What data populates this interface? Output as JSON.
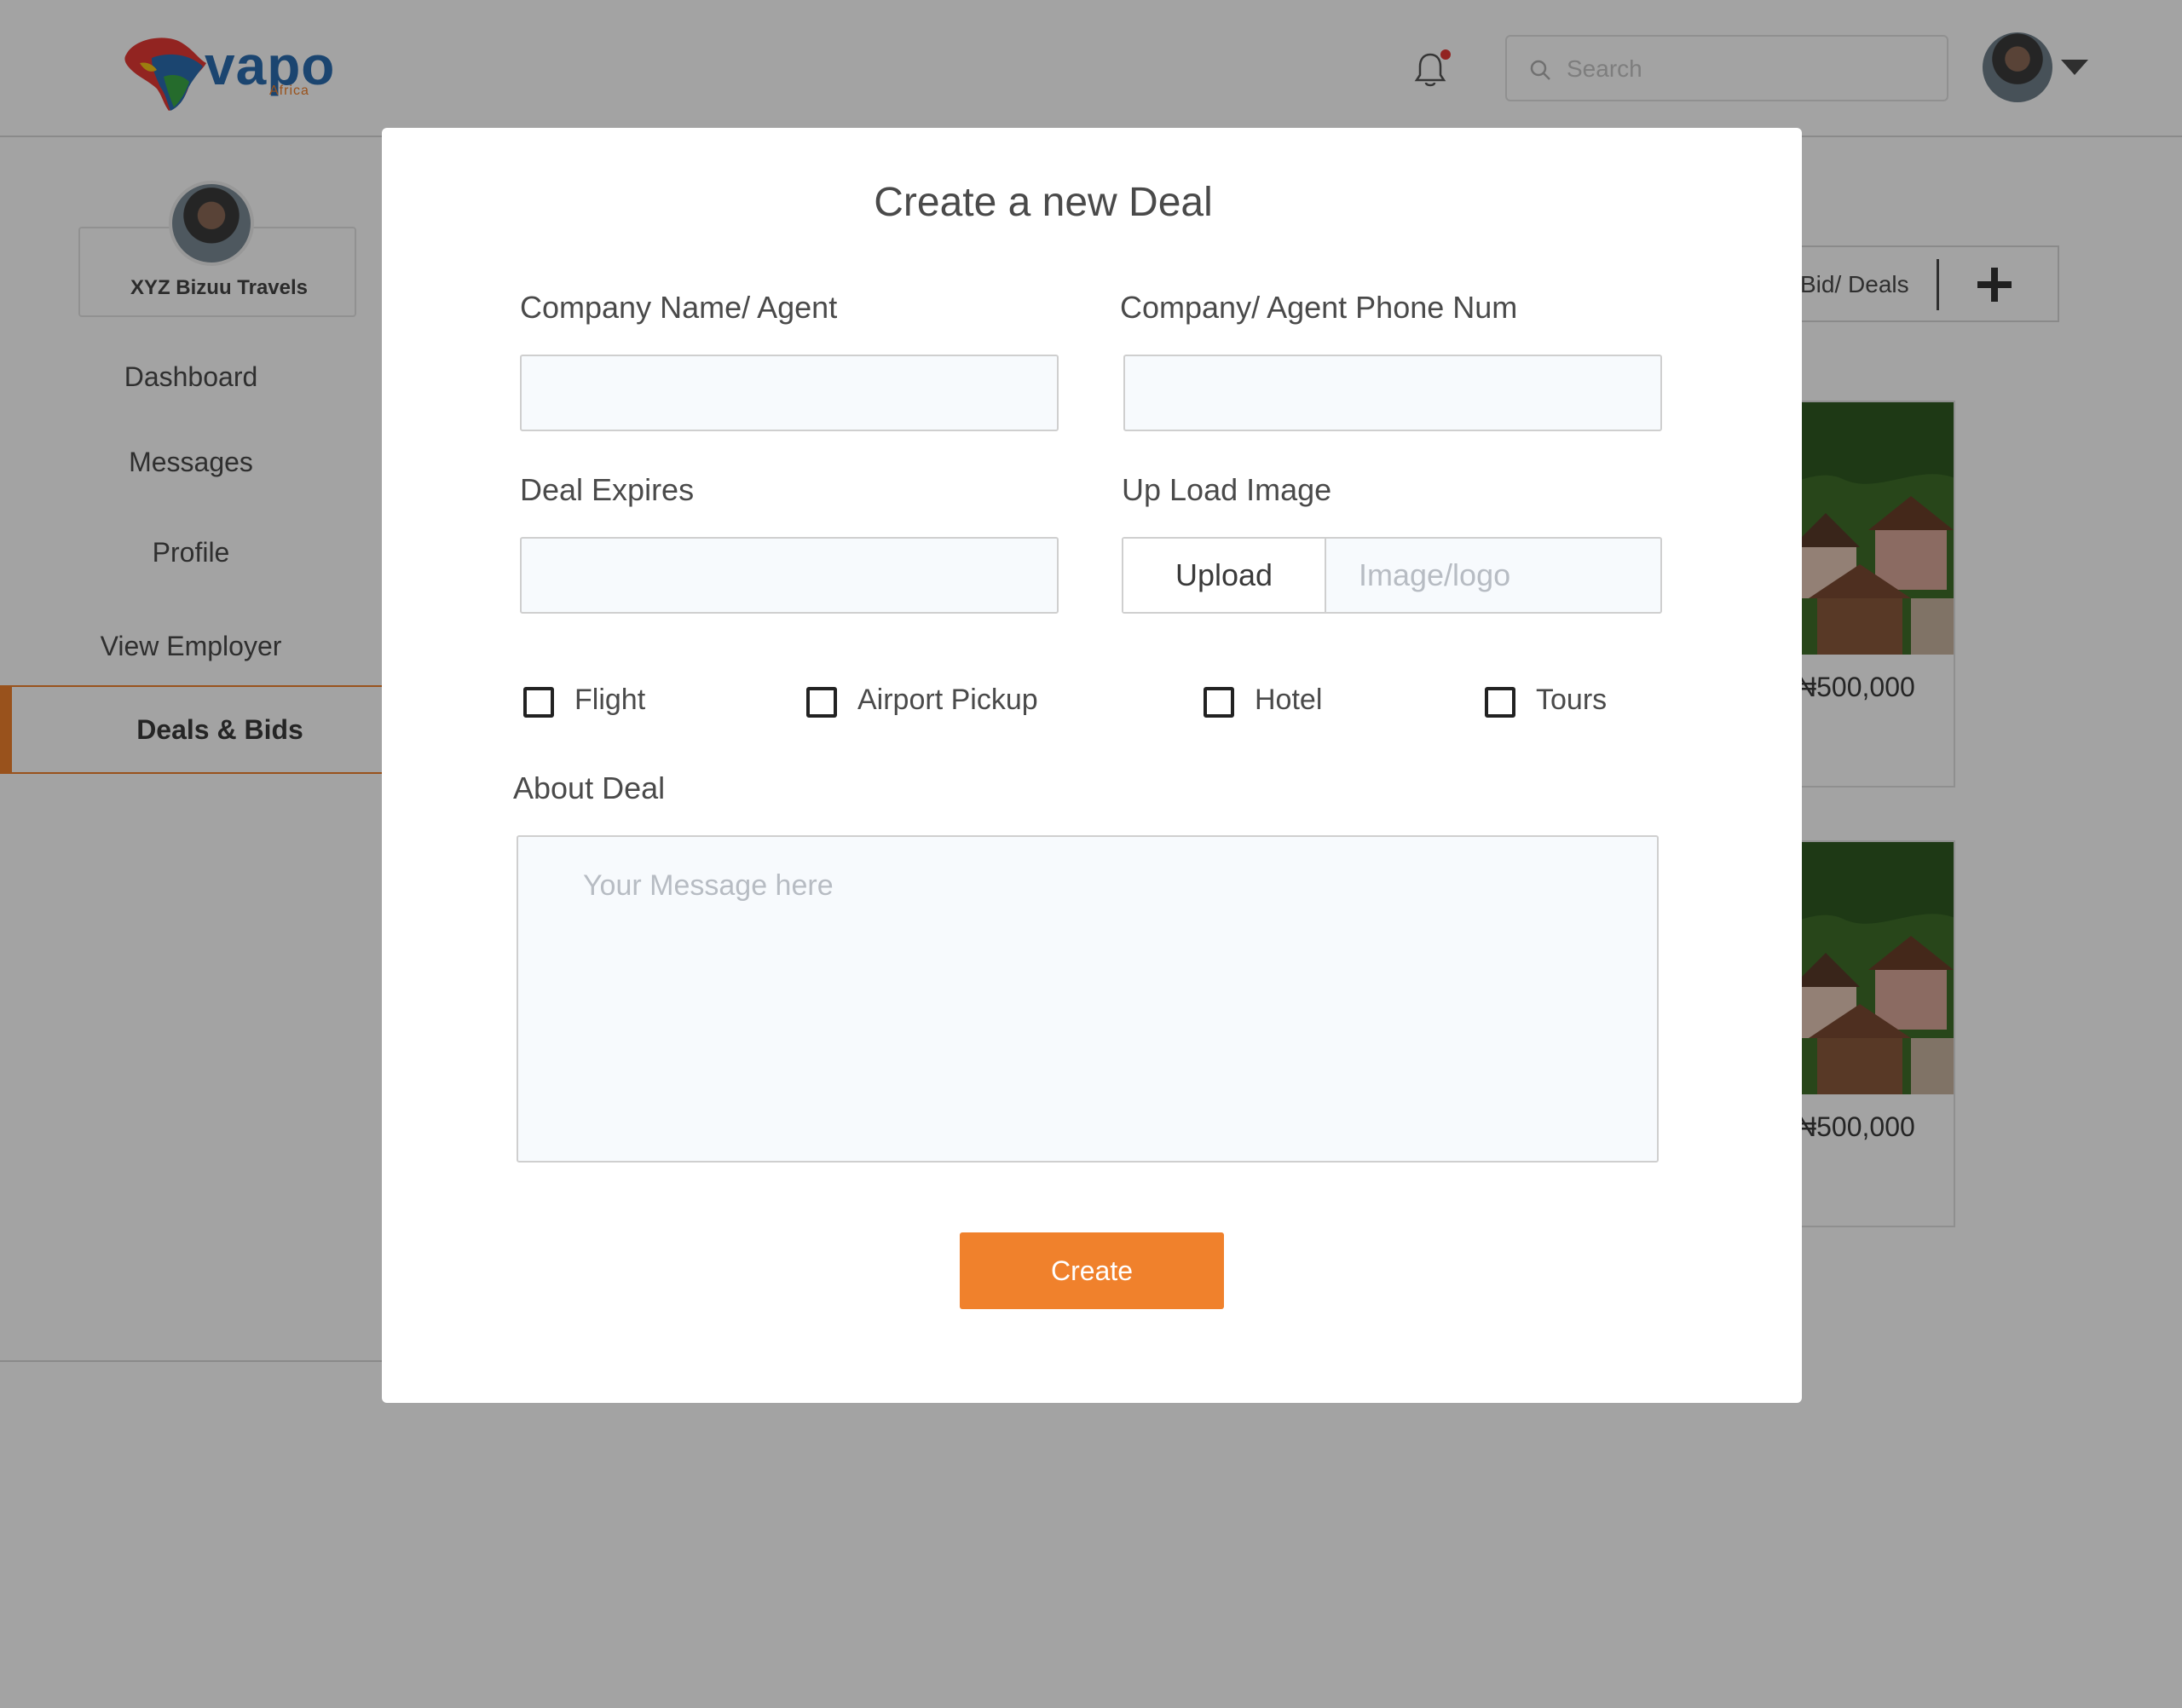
{
  "brand": {
    "name": "vapo",
    "sub": "Africa",
    "colors": {
      "blue": "#2b6cb0",
      "orange": "#f0812c",
      "red": "#e53935",
      "green": "#3aa845",
      "yellow": "#f5c518"
    }
  },
  "header": {
    "search_placeholder": "Search",
    "notification_icon": "bell-icon"
  },
  "sidebar": {
    "company_name": "XYZ  Bizuu Travels",
    "items": [
      {
        "label": "Dashboard"
      },
      {
        "label": "Messages"
      },
      {
        "label": "Profile"
      },
      {
        "label": "View Employer"
      },
      {
        "label": "Deals & Bids",
        "active": true
      }
    ]
  },
  "main": {
    "tab_label": "Bid/ Deals",
    "deals": [
      {
        "price": "₦500,000"
      },
      {
        "price": "₦500,000"
      }
    ]
  },
  "modal": {
    "title": "Create a new Deal",
    "company_name_label": "Company Name/ Agent",
    "company_name_value": "",
    "phone_label": "Company/ Agent Phone Num",
    "phone_value": "",
    "expires_label": "Deal Expires",
    "expires_value": "",
    "upload_label": "Up Load Image",
    "upload_button": "Upload",
    "upload_placeholder": "Image/logo",
    "options": [
      {
        "label": "Flight",
        "checked": false
      },
      {
        "label": "Airport Pickup",
        "checked": false
      },
      {
        "label": "Hotel",
        "checked": false
      },
      {
        "label": "Tours",
        "checked": false
      }
    ],
    "about_label": "About Deal",
    "about_placeholder": "Your Message here",
    "about_value": "",
    "create_button": "Create"
  }
}
